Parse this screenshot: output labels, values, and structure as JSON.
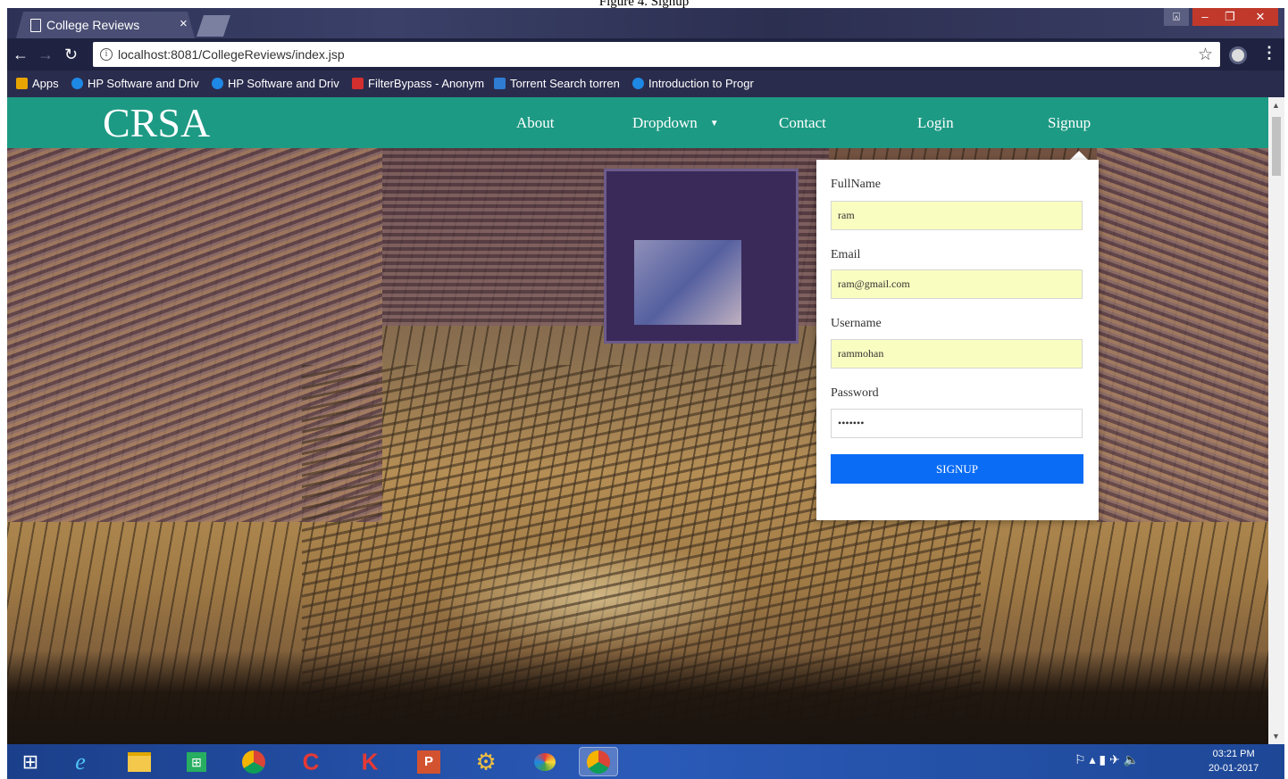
{
  "document": {
    "caption": "Figure 4. Signup"
  },
  "browser": {
    "tab": {
      "title": "College Reviews"
    },
    "address": {
      "url": "localhost:8081/CollegeReviews/index.jsp"
    },
    "bookmarks": [
      {
        "label": "Apps",
        "icon": "apps-grid-icon",
        "color": "#e8a400"
      },
      {
        "label": "HP Software and Driv",
        "icon": "hp-icon",
        "color": "#1e88e5"
      },
      {
        "label": "HP Software and Driv",
        "icon": "hp-icon",
        "color": "#1e88e5"
      },
      {
        "label": "FilterBypass - Anonym",
        "icon": "filterbypass-icon",
        "color": "#d32f2f"
      },
      {
        "label": "Torrent Search torren",
        "icon": "torrent-icon",
        "color": "#2e7dd2"
      },
      {
        "label": "Introduction to Progr",
        "icon": "course-icon",
        "color": "#1e88e5"
      }
    ]
  },
  "site": {
    "brand": "CRSA",
    "nav": [
      {
        "label": "About"
      },
      {
        "label": "Dropdown"
      },
      {
        "label": "Contact"
      },
      {
        "label": "Login"
      },
      {
        "label": "Signup"
      }
    ],
    "colors": {
      "navbar": "#1d9a84",
      "button": "#0a6cf5"
    }
  },
  "signup_form": {
    "fullname": {
      "label": "FullName",
      "value": "ram"
    },
    "email": {
      "label": "Email",
      "value": "ram@gmail.com"
    },
    "username": {
      "label": "Username",
      "value": "rammohan"
    },
    "password": {
      "label": "Password",
      "value": "•••••••"
    },
    "submit_label": "SIGNUP"
  },
  "taskbar": {
    "apps": [
      "windows-start-icon",
      "internet-explorer-icon",
      "file-explorer-icon",
      "store-icon",
      "chrome-icon",
      "ccleaner-icon",
      "kaspersky-icon",
      "powerpoint-icon",
      "settings-app-icon",
      "paint-icon",
      "chrome-icon"
    ],
    "clock": {
      "time": "03:21 PM",
      "date": "20-01-2017"
    }
  }
}
